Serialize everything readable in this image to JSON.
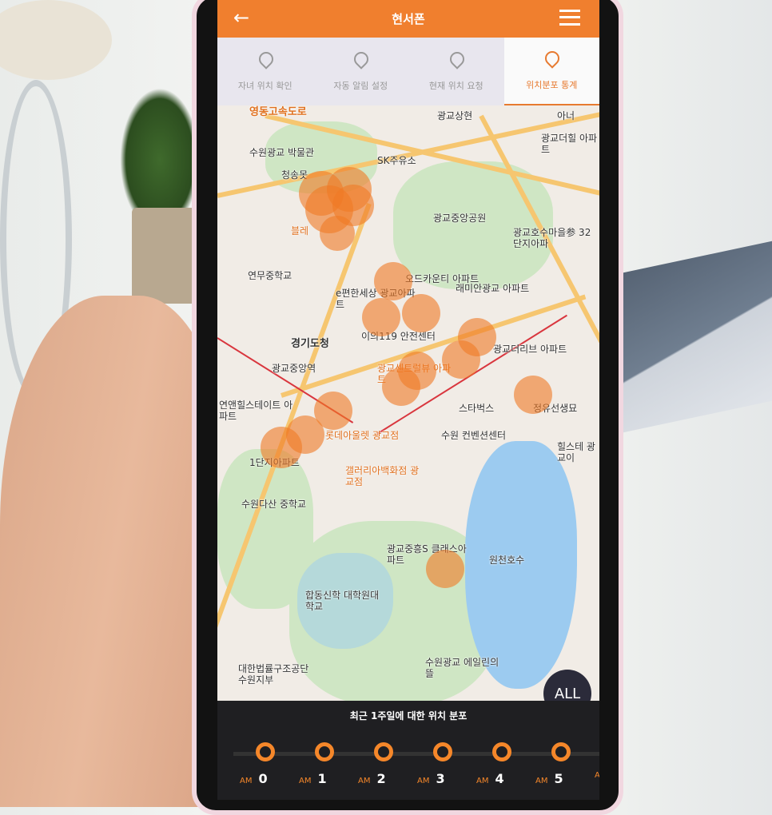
{
  "header": {
    "title": "현서폰",
    "back_icon": "arrow-left-icon",
    "menu_icon": "hamburger-menu-icon"
  },
  "tabs": [
    {
      "label": "자녀 위치 확인",
      "icon": "map-pin-icon",
      "active": false
    },
    {
      "label": "자동 알림 설정",
      "icon": "map-pin-icon",
      "active": false
    },
    {
      "label": "현재 위치 요청",
      "icon": "map-pin-upload-icon",
      "active": false
    },
    {
      "label": "위치분포 통계",
      "icon": "map-pin-chart-icon",
      "active": true
    }
  ],
  "map": {
    "labels": [
      "영동고속도로",
      "광교상현",
      "아너",
      "광교더힐 아파트",
      "수원광교 박물관",
      "청송못",
      "SK주유소",
      "광교중앙공원",
      "블레",
      "광교호수마을参 32단지아파",
      "연무중학교",
      "오드카운티 아파트",
      "e편한세상 광교아파트",
      "래미안광교 아파트",
      "이의119 안전센터",
      "경기도청",
      "광교더리브 아파트",
      "광교중앙역",
      "광교센트럴뷰 아파트",
      "연앤힐스테이트 아파트",
      "스타벅스",
      "정유선생묘",
      "롯데아울렛 광교점",
      "수원 컨벤션센터",
      "1단지아파트",
      "갤러리아백화점 광교점",
      "수원다산 중학교",
      "광교중흥S 클래스아파트",
      "원천호수",
      "합동신학 대학원대학교",
      "대한법률구조공단 수원지부",
      "수원광교 에일린의뜰",
      "힐스테 광교이"
    ],
    "accent_color": "#f07a25"
  },
  "all_button": "ALL",
  "panel": {
    "caption": "최근 1주일에 대한 위치 분포",
    "hours": [
      {
        "am": "AM",
        "h": "0"
      },
      {
        "am": "AM",
        "h": "1"
      },
      {
        "am": "AM",
        "h": "2"
      },
      {
        "am": "AM",
        "h": "3"
      },
      {
        "am": "AM",
        "h": "4"
      },
      {
        "am": "AM",
        "h": "5"
      },
      {
        "am": "AM",
        "h": ""
      }
    ]
  },
  "colors": {
    "primary": "#f07f2e",
    "panel_bg": "#1f1f22"
  }
}
